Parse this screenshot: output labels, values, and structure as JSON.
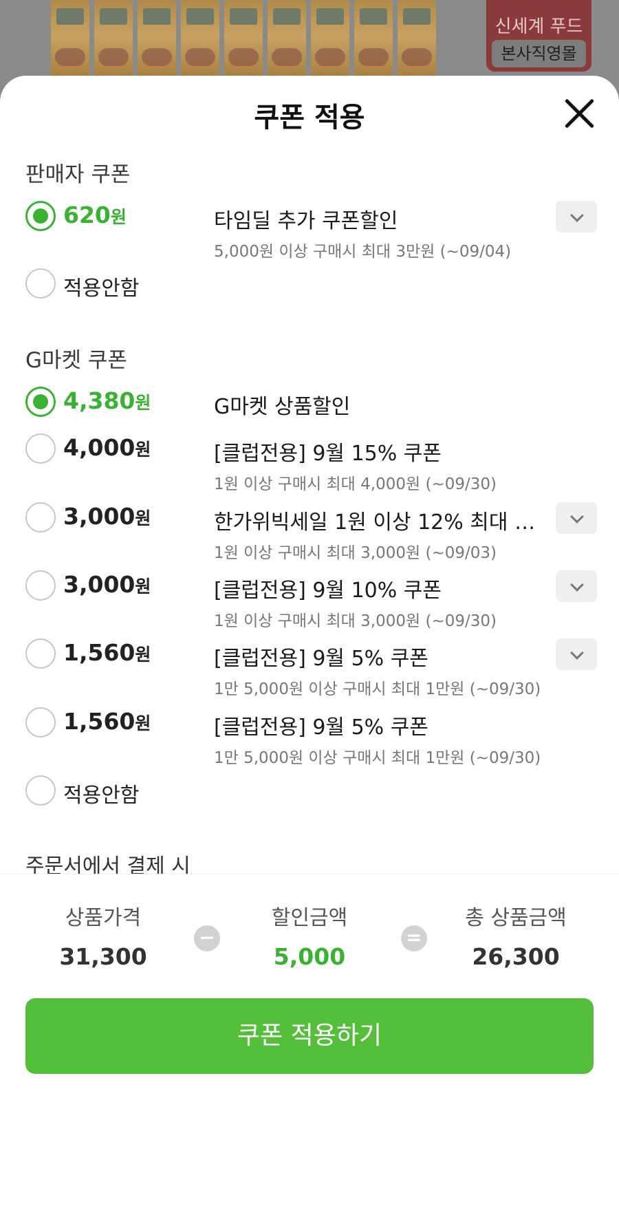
{
  "banner": {
    "brand_top": "신세계 푸드",
    "brand_bottom": "본사직영몰"
  },
  "sheet": {
    "title": "쿠폰 적용",
    "close_icon": "close-icon"
  },
  "seller": {
    "title": "판매자 쿠폰",
    "items": [
      {
        "amount": "620",
        "unit": "원",
        "selected": true,
        "title": "타임딜 추가 쿠폰할인",
        "desc": "5,000원 이상 구매시 최대 3만원 (~09/04)",
        "expandable": true
      }
    ],
    "none_label": "적용안함"
  },
  "gmarket": {
    "title": "G마켓 쿠폰",
    "items": [
      {
        "amount": "4,380",
        "unit": "원",
        "selected": true,
        "title": "G마켓 상품할인",
        "desc": "",
        "expandable": false
      },
      {
        "amount": "4,000",
        "unit": "원",
        "selected": false,
        "title": "[클럽전용] 9월 15% 쿠폰",
        "desc": "1원 이상 구매시 최대 4,000원 (~09/30)",
        "expandable": false
      },
      {
        "amount": "3,000",
        "unit": "원",
        "selected": false,
        "title": "한가위빅세일 1원 이상 12% 최대 3...",
        "desc": "1원 이상 구매시 최대 3,000원 (~09/03)",
        "expandable": true
      },
      {
        "amount": "3,000",
        "unit": "원",
        "selected": false,
        "title": "[클럽전용] 9월 10% 쿠폰",
        "desc": "1원 이상 구매시 최대 3,000원 (~09/30)",
        "expandable": true
      },
      {
        "amount": "1,560",
        "unit": "원",
        "selected": false,
        "title": "[클럽전용] 9월 5% 쿠폰",
        "desc": "1만 5,000원 이상 구매시 최대 1만원 (~09/30)",
        "expandable": true
      },
      {
        "amount": "1,560",
        "unit": "원",
        "selected": false,
        "title": "[클럽전용] 9월 5% 쿠폰",
        "desc": "1만 5,000원 이상 구매시 최대 1만원 (~09/30)",
        "expandable": false
      }
    ],
    "none_label": "적용안함"
  },
  "checkout_text": "주문서에서 결제 시",
  "summary": {
    "price_label": "상품가격",
    "price_value": "31,300",
    "minus_symbol": "−",
    "discount_label": "할인금액",
    "discount_value": "5,000",
    "equals_symbol": "=",
    "total_label": "총 상품금액",
    "total_value": "26,300"
  },
  "apply_button": "쿠폰 적용하기",
  "colors": {
    "accent": "#39b131",
    "button": "#55bf3b"
  }
}
